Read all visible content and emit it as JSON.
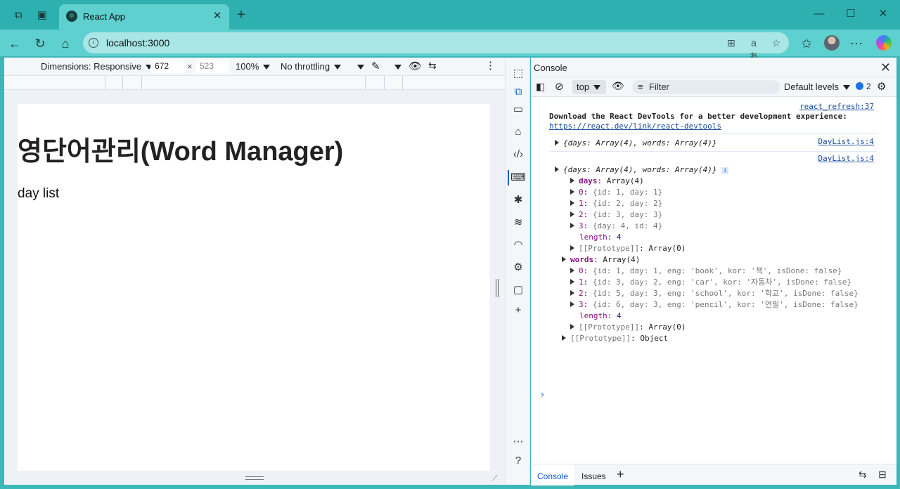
{
  "browser": {
    "tab_title": "React App",
    "url": "localhost:3000"
  },
  "device_toolbar": {
    "dimensions_label": "Dimensions: Responsive",
    "width": "672",
    "times": "×",
    "height": "523",
    "zoom": "100%",
    "throttling": "No throttling"
  },
  "page": {
    "heading": "영단어관리(Word Manager)",
    "subtitle": "day list"
  },
  "console": {
    "panel_title": "Console",
    "context": "top",
    "filter_placeholder": "Filter",
    "levels": "Default levels",
    "issues_count": "2",
    "footer_tabs": [
      "Console",
      "Issues"
    ],
    "messages": {
      "src1": "react_refresh:37",
      "devtools_msg": "Download the React DevTools for a better development experience:",
      "devtools_link": "https://react.dev/link/react-devtools",
      "src2": "DayList.js:4",
      "obj1": "{days: Array(4), words: Array(4)}",
      "src3": "DayList.js:4",
      "obj2": "{days: Array(4), words: Array(4)}",
      "days_key": "days",
      "days_val": "Array(4)",
      "days_items": [
        "{id: 1, day: 1}",
        "{id: 2, day: 2}",
        "{id: 3, day: 3}",
        "{day: 4, id: 4}"
      ],
      "length_key": "length",
      "length_val": "4",
      "proto_key": "[[Prototype]]",
      "proto_arr": "Array(0)",
      "words_key": "words",
      "words_val": "Array(4)",
      "words_items": [
        "{id: 1, day: 1, eng: 'book', kor: '책', isDone: false}",
        "{id: 3, day: 2, eng: 'car', kor: '자동차', isDone: false}",
        "{id: 5, day: 3, eng: 'school', kor: '학교', isDone: false}",
        "{id: 6, day: 3, eng: 'pencil', kor: '연필', isDone: false}"
      ],
      "proto_obj": "Object"
    }
  }
}
